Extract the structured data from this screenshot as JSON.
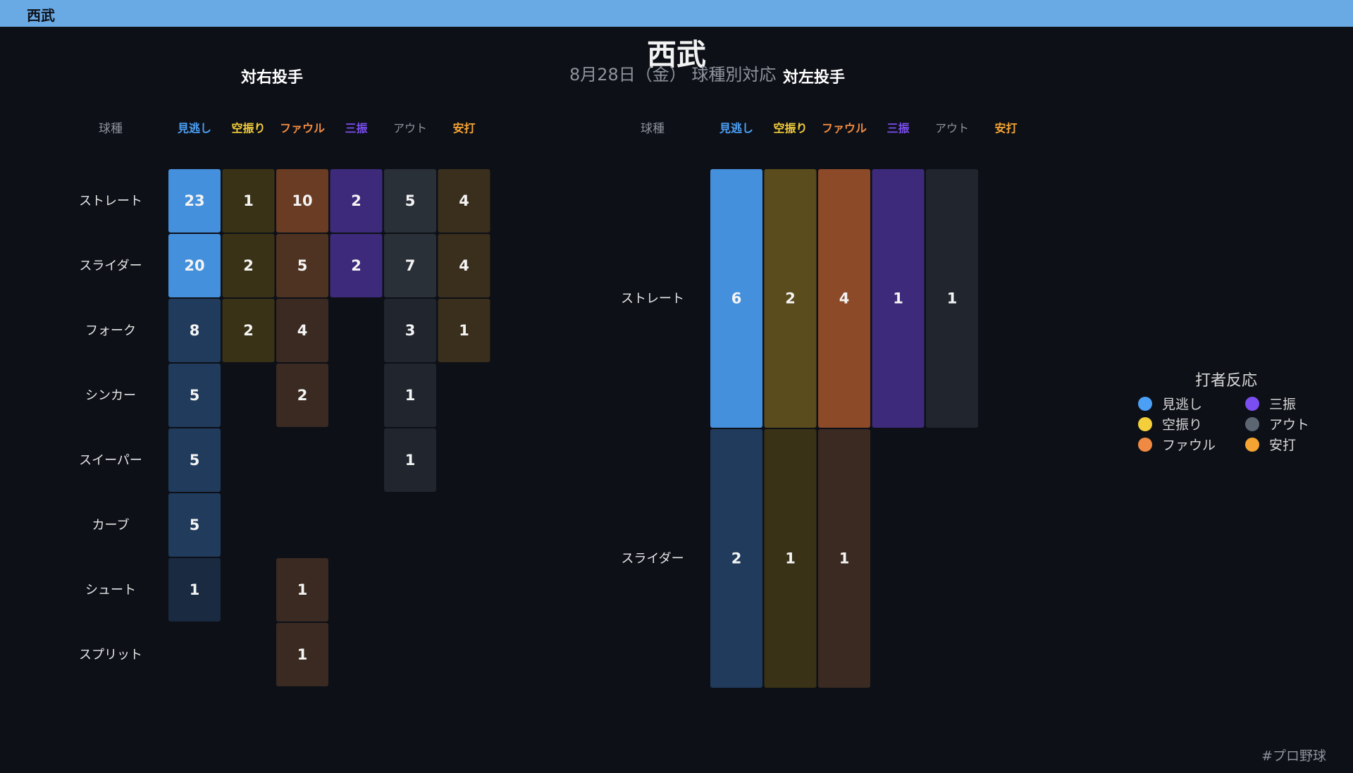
{
  "header": {
    "tab_title": "西武"
  },
  "title": "西武",
  "subtitle": "8月28日（金） 球種別対応",
  "hashtag": "#プロ野球",
  "legend": {
    "title": "打者反応",
    "items": [
      {
        "label": "見逃し",
        "color": "#4b9ff5"
      },
      {
        "label": "三振",
        "color": "#7b4ef2"
      },
      {
        "label": "空振り",
        "color": "#f5cf3b"
      },
      {
        "label": "アウト",
        "color": "#5c6673"
      },
      {
        "label": "ファウル",
        "color": "#f08a42"
      },
      {
        "label": "安打",
        "color": "#f5a332"
      }
    ]
  },
  "chart_data": [
    {
      "type": "heatmap",
      "title": "対右投手",
      "row_header": "球種",
      "columns": [
        "見逃し",
        "空振り",
        "ファウル",
        "三振",
        "アウト",
        "安打"
      ],
      "column_colors": [
        "#4b9ff5",
        "#f5cf3b",
        "#f08a42",
        "#7b4ef2",
        "#8e939c",
        "#f5a332"
      ],
      "rows": [
        "ストレート",
        "スライダー",
        "フォーク",
        "シンカー",
        "スイーパー",
        "カーブ",
        "シュート",
        "スプリット"
      ],
      "values": [
        [
          23,
          1,
          10,
          2,
          5,
          4
        ],
        [
          20,
          2,
          5,
          2,
          7,
          4
        ],
        [
          8,
          2,
          4,
          null,
          3,
          1
        ],
        [
          5,
          null,
          2,
          null,
          1,
          null
        ],
        [
          5,
          null,
          null,
          null,
          1,
          null
        ],
        [
          5,
          null,
          null,
          null,
          null,
          null
        ],
        [
          1,
          null,
          1,
          null,
          null,
          null
        ],
        [
          null,
          null,
          1,
          null,
          null,
          null
        ]
      ]
    },
    {
      "type": "heatmap",
      "title": "対左投手",
      "row_header": "球種",
      "columns": [
        "見逃し",
        "空振り",
        "ファウル",
        "三振",
        "アウト",
        "安打"
      ],
      "column_colors": [
        "#4b9ff5",
        "#f5cf3b",
        "#f08a42",
        "#7b4ef2",
        "#8e939c",
        "#f5a332"
      ],
      "rows": [
        "ストレート",
        "スライダー"
      ],
      "values": [
        [
          6,
          2,
          4,
          1,
          1,
          null
        ],
        [
          2,
          1,
          1,
          null,
          null,
          null
        ]
      ]
    }
  ]
}
